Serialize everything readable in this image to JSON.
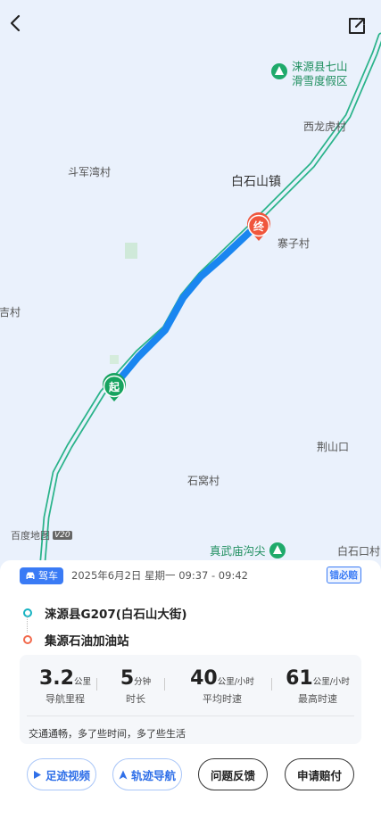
{
  "map": {
    "places": {
      "qishan_resort": "涞源县七山\n滑雪度假区",
      "xilonghu": "西龙虎村",
      "doujunwan": "斗军湾村",
      "baishishan": "白石山镇",
      "zhaizi": "寨子村",
      "jicun": "吉村",
      "jingshankou": "荆山口",
      "shiwo": "石窝村",
      "zhenwumiao": "真武庙沟尖",
      "baishikou": "白石口村"
    },
    "start_marker": "起",
    "end_marker": "终",
    "watermark": "百度地图",
    "watermark_version": "V20",
    "colors": {
      "route": "#1a86f0",
      "road": "#2ab38a",
      "map_bg": "#eaf1fc"
    }
  },
  "trip": {
    "mode": "驾车",
    "date": "2025年6月2日 星期一 09:37 - 09:42",
    "guarantee": "错必赔",
    "origin": "涞源县G207(白石山大街)",
    "destination": "集源石油加油站"
  },
  "stats": [
    {
      "value": "3.2",
      "unit": "公里",
      "label": "导航里程"
    },
    {
      "value": "5",
      "unit": "分钟",
      "label": "时长"
    },
    {
      "value": "40",
      "unit": "公里/小时",
      "label": "平均时速"
    },
    {
      "value": "61",
      "unit": "公里/小时",
      "label": "最高时速"
    }
  ],
  "summary": "交通通畅，多了些时间，多了些生活",
  "buttons": {
    "trail_video": "足迹视频",
    "trail_nav": "轨迹导航",
    "feedback": "问题反馈",
    "claim": "申请赔付"
  }
}
